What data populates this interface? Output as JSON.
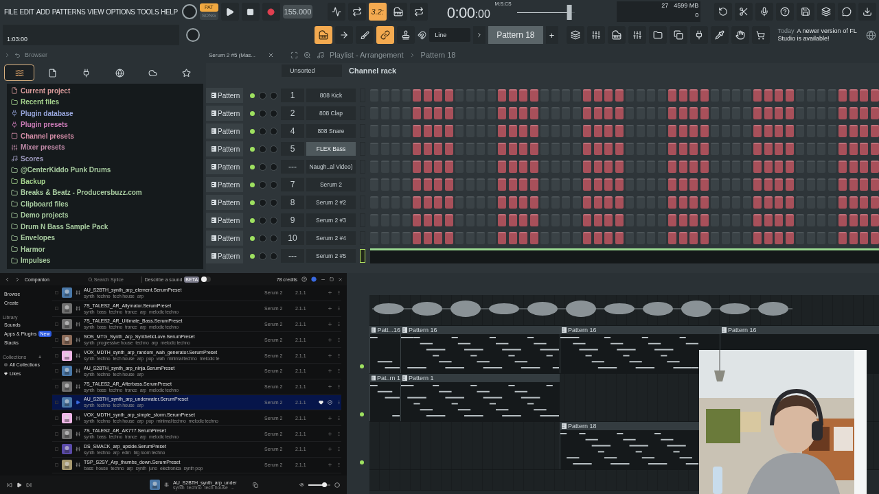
{
  "menu": [
    "FILE",
    "EDIT",
    "ADD",
    "PATTERNS",
    "VIEW",
    "OPTIONS",
    "TOOLS",
    "HELP"
  ],
  "transport": {
    "modes": [
      {
        "label": "PAT",
        "selected": true
      },
      {
        "label": "SONG",
        "selected": false
      }
    ],
    "tempo": "155.000"
  },
  "top_tools": [
    {
      "kind": "wave",
      "on": false
    },
    {
      "kind": "loop",
      "on": false
    },
    {
      "kind": "text",
      "label": "3.2:",
      "on": true
    },
    {
      "kind": "piano",
      "on": false
    },
    {
      "kind": "loop",
      "on": false
    }
  ],
  "time": {
    "main": "0:00",
    "sub": ":00",
    "units": "M:S:CS"
  },
  "master_volume": {
    "level": 0.9
  },
  "monitor": {
    "cpu": "27",
    "memory": "4599 MB",
    "polyphony": "0"
  },
  "hint": {
    "time": "1:03:00"
  },
  "edit_tools": [
    {
      "kind": "piano",
      "on": true
    },
    {
      "kind": "arrow",
      "on": false
    },
    {
      "kind": "brush",
      "on": false
    },
    {
      "kind": "link",
      "on": true
    },
    {
      "kind": "stamp",
      "on": false
    }
  ],
  "snap": "Line",
  "pattern": {
    "name": "Pattern 18",
    "add": "+"
  },
  "news": {
    "date": "Today",
    "text": "A newer version of FL Studio is available!"
  },
  "browser": {
    "title": "Browser",
    "tabs": [
      {
        "kind": "all",
        "selected": true
      },
      {
        "kind": "file",
        "selected": false
      },
      {
        "kind": "plugin",
        "selected": false
      },
      {
        "kind": "globe",
        "selected": false
      },
      {
        "kind": "cloud",
        "selected": false
      },
      {
        "kind": "star",
        "selected": false
      }
    ],
    "items": [
      {
        "label": "Current project",
        "kind": "file",
        "color": "#d89a9a"
      },
      {
        "label": "Recent files",
        "kind": "folder",
        "color": "#a6d48e"
      },
      {
        "label": "Plugin database",
        "kind": "plugin",
        "color": "#98a6dc"
      },
      {
        "label": "Plugin presets",
        "kind": "plugin",
        "color": "#cc7cb8"
      },
      {
        "label": "Channel presets",
        "kind": "channel",
        "color": "#d48ea8"
      },
      {
        "label": "Mixer presets",
        "kind": "mixer",
        "color": "#c08aa8"
      },
      {
        "label": "Scores",
        "kind": "note",
        "color": "#a09cc0"
      },
      {
        "label": "@CenterKiddo Punk Drums",
        "kind": "folder",
        "color": "#a8cca0"
      },
      {
        "label": "Backup",
        "kind": "folder",
        "color": "#a6d48e"
      },
      {
        "label": "Breaks & Beatz - Producersbuzz.com",
        "kind": "folder",
        "color": "#a8cca0"
      },
      {
        "label": "Clipboard files",
        "kind": "folder",
        "color": "#a8cca0"
      },
      {
        "label": "Demo projects",
        "kind": "folder",
        "color": "#a8cca0"
      },
      {
        "label": "Drum N Bass Sample Pack",
        "kind": "folder",
        "color": "#a8cca0"
      },
      {
        "label": "Envelopes",
        "kind": "folder",
        "color": "#a8cca0"
      },
      {
        "label": "Harmor",
        "kind": "folder",
        "color": "#a8cca0"
      },
      {
        "label": "Impulses",
        "kind": "folder",
        "color": "#a8cca0"
      }
    ]
  },
  "plugin_window_title": "Serum 2 #5 (Mas...",
  "playlist_header": {
    "title": "Playlist - Arrangement",
    "crumb": "Pattern 18"
  },
  "channel_rack": {
    "filter": "Unsorted",
    "title": "Channel rack",
    "channels": [
      {
        "track_label": "Pattern",
        "number": "1",
        "name": "808 Kick",
        "on": true,
        "selected": false,
        "highlighted": false,
        "kind": "steps"
      },
      {
        "track_label": "Pattern",
        "number": "2",
        "name": "808 Clap",
        "on": true,
        "selected": false,
        "highlighted": false,
        "kind": "steps"
      },
      {
        "track_label": "Pattern",
        "number": "4",
        "name": "808 Snare",
        "on": true,
        "selected": false,
        "highlighted": false,
        "kind": "steps"
      },
      {
        "track_label": "Pattern",
        "number": "5",
        "name": "FLEX Bass",
        "on": true,
        "selected": false,
        "highlighted": true,
        "kind": "steps"
      },
      {
        "track_label": "Pattern",
        "number": "---",
        "name": "Naugh..al Video)",
        "on": true,
        "selected": false,
        "highlighted": false,
        "kind": "steps"
      },
      {
        "track_label": "Pattern",
        "number": "7",
        "name": "Serum 2",
        "on": true,
        "selected": false,
        "highlighted": false,
        "kind": "steps"
      },
      {
        "track_label": "Pattern",
        "number": "8",
        "name": "Serum 2 #2",
        "on": true,
        "selected": false,
        "highlighted": false,
        "kind": "steps"
      },
      {
        "track_label": "Pattern",
        "number": "9",
        "name": "Serum 2 #3",
        "on": true,
        "selected": false,
        "highlighted": false,
        "kind": "steps"
      },
      {
        "track_label": "Pattern",
        "number": "10",
        "name": "Serum 2 #4",
        "on": true,
        "selected": false,
        "highlighted": false,
        "kind": "steps"
      },
      {
        "track_label": "Pattern",
        "number": "---",
        "name": "Serum 2 #5",
        "on": true,
        "selected": true,
        "highlighted": false,
        "kind": "pianoroll"
      }
    ]
  },
  "companion": {
    "title": "Companion",
    "search": {
      "placeholder": "Search Splice"
    },
    "describe": {
      "label": "Describe a sound",
      "badge": "BETA",
      "on": false
    },
    "credits": "78 credits",
    "nav": [
      {
        "label": "Browse",
        "kind": "link"
      },
      {
        "label": "Create",
        "kind": "link"
      },
      {
        "label": "Library",
        "kind": "heading"
      },
      {
        "label": "Sounds",
        "kind": "link"
      },
      {
        "label": "Apps & Plugins",
        "kind": "link",
        "badge": "New"
      },
      {
        "label": "Stacks",
        "kind": "link"
      },
      {
        "label": "Collections",
        "kind": "heading",
        "add": "+"
      },
      {
        "label": "All Collections",
        "kind": "collection"
      },
      {
        "label": "Likes",
        "kind": "likes"
      }
    ],
    "presets": [
      {
        "name": "AU_S2BTH_synth_arp_element.SerumPreset",
        "tags": [
          "synth",
          "techno",
          "tech house",
          "arp"
        ],
        "plugin": "Serum 2",
        "version": "2.1.1",
        "color": "#4a78a8",
        "selected": false
      },
      {
        "name": "7S_TALES2_AR_Allymator.SerumPreset",
        "tags": [
          "synth",
          "bass",
          "techno",
          "trance",
          "arp",
          "melodic techno"
        ],
        "plugin": "Serum 2",
        "version": "2.1.1",
        "color": "#707070",
        "selected": false
      },
      {
        "name": "7S_TALES2_AR_Ultimate_Bass.SerumPreset",
        "tags": [
          "synth",
          "bass",
          "techno",
          "trance",
          "arp",
          "melodic techno"
        ],
        "plugin": "Serum 2",
        "version": "2.1.1",
        "color": "#707070",
        "selected": false
      },
      {
        "name": "SOS_MTG_Synth_Arp_SyntheticLove.SerumPreset",
        "tags": [
          "synth",
          "progressive house",
          "techno",
          "arp",
          "melodic techno"
        ],
        "plugin": "Serum 2",
        "version": "2.1.1",
        "color": "#8a6a58",
        "selected": false
      },
      {
        "name": "VOX_MDTH_synth_arp_random_wah_generator.SerumPreset",
        "tags": [
          "synth",
          "techno",
          "tech house",
          "arp",
          "pop",
          "wah",
          "minimal techno",
          "melodic te"
        ],
        "plugin": "Serum 2",
        "version": "2.1.1",
        "color": "#f0b8e8",
        "selected": false
      },
      {
        "name": "AU_S2BTH_synth_arp_ninja.SerumPreset",
        "tags": [
          "synth",
          "techno",
          "tech house",
          "arp"
        ],
        "plugin": "Serum 2",
        "version": "2.1.1",
        "color": "#4a78a8",
        "selected": false
      },
      {
        "name": "7S_TALES2_AR_Afterbass.SerumPreset",
        "tags": [
          "synth",
          "bass",
          "techno",
          "trance",
          "arp",
          "melodic techno"
        ],
        "plugin": "Serum 2",
        "version": "2.1.1",
        "color": "#707070",
        "selected": false
      },
      {
        "name": "AU_S2BTH_synth_arp_underwater.SerumPreset",
        "tags": [
          "synth",
          "techno",
          "tech house",
          "arp"
        ],
        "plugin": "Serum 2",
        "version": "2.1.1",
        "color": "#4a78a8",
        "selected": true
      },
      {
        "name": "VOX_MDTH_synth_arp_simple_storm.SerumPreset",
        "tags": [
          "synth",
          "techno",
          "tech house",
          "arp",
          "pop",
          "minimal techno",
          "melodic techno"
        ],
        "plugin": "Serum 2",
        "version": "2.1.1",
        "color": "#f0b8e8",
        "selected": false
      },
      {
        "name": "7S_TALES2_AR_AK777.SerumPreset",
        "tags": [
          "synth",
          "bass",
          "techno",
          "trance",
          "arp",
          "melodic techno"
        ],
        "plugin": "Serum 2",
        "version": "2.1.1",
        "color": "#707070",
        "selected": false
      },
      {
        "name": "DS_SMACK_arp_upside.SerumPreset",
        "tags": [
          "synth",
          "techno",
          "arp",
          "edm",
          "big room techno"
        ],
        "plugin": "Serum 2",
        "version": "2.1.1",
        "color": "#5a4aa8",
        "selected": false
      },
      {
        "name": "TSP_S2SY_Arp_thumbs_down.SerumPreset",
        "tags": [
          "bass",
          "house",
          "techno",
          "arp",
          "synth",
          "juno",
          "electronica",
          "synth pop"
        ],
        "plugin": "Serum 2",
        "version": "2.1.1",
        "color": "#a89a70",
        "selected": false
      }
    ],
    "player": {
      "name": "AU_S2BTH_synth_arp_under",
      "tags": "synth  techno  tech house  ...",
      "level": 0.72
    }
  },
  "playlist": {
    "tracks": [
      {
        "kind": "audio"
      },
      {
        "kind": "pattern",
        "clips": [
          {
            "label": "Patt...16"
          },
          {
            "label": "Pattern 16"
          },
          {
            "label": "Pattern 16"
          },
          {
            "label": "Pattern 16"
          }
        ]
      },
      {
        "kind": "pattern",
        "clips": [
          {
            "label": "Pat..rn 1"
          },
          {
            "label": "Pattern 1"
          }
        ]
      },
      {
        "kind": "pattern",
        "clips": [
          {
            "label": "Pattern 18"
          }
        ]
      },
      {
        "kind": "empty"
      }
    ]
  }
}
